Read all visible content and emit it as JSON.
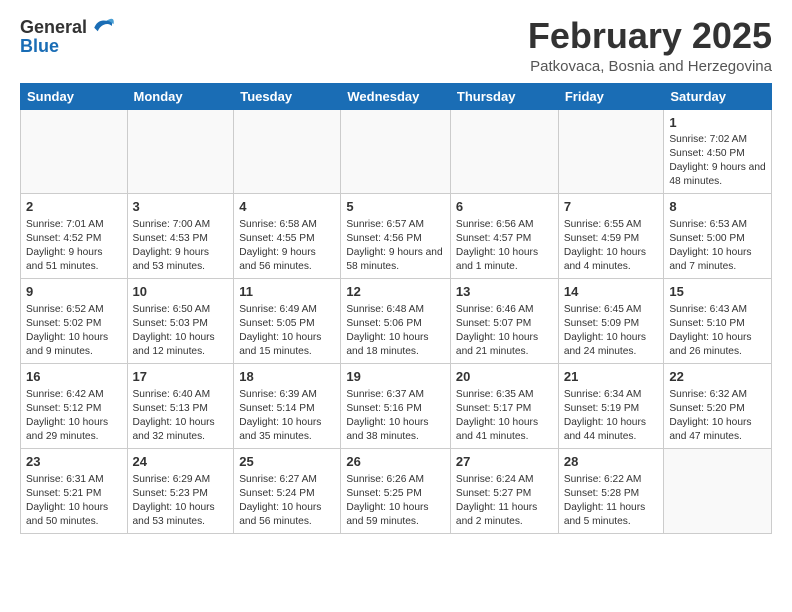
{
  "header": {
    "logo_line1": "General",
    "logo_line2": "Blue",
    "title": "February 2025",
    "subtitle": "Patkovaca, Bosnia and Herzegovina"
  },
  "days_of_week": [
    "Sunday",
    "Monday",
    "Tuesday",
    "Wednesday",
    "Thursday",
    "Friday",
    "Saturday"
  ],
  "weeks": [
    [
      {
        "day": "",
        "info": ""
      },
      {
        "day": "",
        "info": ""
      },
      {
        "day": "",
        "info": ""
      },
      {
        "day": "",
        "info": ""
      },
      {
        "day": "",
        "info": ""
      },
      {
        "day": "",
        "info": ""
      },
      {
        "day": "1",
        "info": "Sunrise: 7:02 AM\nSunset: 4:50 PM\nDaylight: 9 hours and 48 minutes."
      }
    ],
    [
      {
        "day": "2",
        "info": "Sunrise: 7:01 AM\nSunset: 4:52 PM\nDaylight: 9 hours and 51 minutes."
      },
      {
        "day": "3",
        "info": "Sunrise: 7:00 AM\nSunset: 4:53 PM\nDaylight: 9 hours and 53 minutes."
      },
      {
        "day": "4",
        "info": "Sunrise: 6:58 AM\nSunset: 4:55 PM\nDaylight: 9 hours and 56 minutes."
      },
      {
        "day": "5",
        "info": "Sunrise: 6:57 AM\nSunset: 4:56 PM\nDaylight: 9 hours and 58 minutes."
      },
      {
        "day": "6",
        "info": "Sunrise: 6:56 AM\nSunset: 4:57 PM\nDaylight: 10 hours and 1 minute."
      },
      {
        "day": "7",
        "info": "Sunrise: 6:55 AM\nSunset: 4:59 PM\nDaylight: 10 hours and 4 minutes."
      },
      {
        "day": "8",
        "info": "Sunrise: 6:53 AM\nSunset: 5:00 PM\nDaylight: 10 hours and 7 minutes."
      }
    ],
    [
      {
        "day": "9",
        "info": "Sunrise: 6:52 AM\nSunset: 5:02 PM\nDaylight: 10 hours and 9 minutes."
      },
      {
        "day": "10",
        "info": "Sunrise: 6:50 AM\nSunset: 5:03 PM\nDaylight: 10 hours and 12 minutes."
      },
      {
        "day": "11",
        "info": "Sunrise: 6:49 AM\nSunset: 5:05 PM\nDaylight: 10 hours and 15 minutes."
      },
      {
        "day": "12",
        "info": "Sunrise: 6:48 AM\nSunset: 5:06 PM\nDaylight: 10 hours and 18 minutes."
      },
      {
        "day": "13",
        "info": "Sunrise: 6:46 AM\nSunset: 5:07 PM\nDaylight: 10 hours and 21 minutes."
      },
      {
        "day": "14",
        "info": "Sunrise: 6:45 AM\nSunset: 5:09 PM\nDaylight: 10 hours and 24 minutes."
      },
      {
        "day": "15",
        "info": "Sunrise: 6:43 AM\nSunset: 5:10 PM\nDaylight: 10 hours and 26 minutes."
      }
    ],
    [
      {
        "day": "16",
        "info": "Sunrise: 6:42 AM\nSunset: 5:12 PM\nDaylight: 10 hours and 29 minutes."
      },
      {
        "day": "17",
        "info": "Sunrise: 6:40 AM\nSunset: 5:13 PM\nDaylight: 10 hours and 32 minutes."
      },
      {
        "day": "18",
        "info": "Sunrise: 6:39 AM\nSunset: 5:14 PM\nDaylight: 10 hours and 35 minutes."
      },
      {
        "day": "19",
        "info": "Sunrise: 6:37 AM\nSunset: 5:16 PM\nDaylight: 10 hours and 38 minutes."
      },
      {
        "day": "20",
        "info": "Sunrise: 6:35 AM\nSunset: 5:17 PM\nDaylight: 10 hours and 41 minutes."
      },
      {
        "day": "21",
        "info": "Sunrise: 6:34 AM\nSunset: 5:19 PM\nDaylight: 10 hours and 44 minutes."
      },
      {
        "day": "22",
        "info": "Sunrise: 6:32 AM\nSunset: 5:20 PM\nDaylight: 10 hours and 47 minutes."
      }
    ],
    [
      {
        "day": "23",
        "info": "Sunrise: 6:31 AM\nSunset: 5:21 PM\nDaylight: 10 hours and 50 minutes."
      },
      {
        "day": "24",
        "info": "Sunrise: 6:29 AM\nSunset: 5:23 PM\nDaylight: 10 hours and 53 minutes."
      },
      {
        "day": "25",
        "info": "Sunrise: 6:27 AM\nSunset: 5:24 PM\nDaylight: 10 hours and 56 minutes."
      },
      {
        "day": "26",
        "info": "Sunrise: 6:26 AM\nSunset: 5:25 PM\nDaylight: 10 hours and 59 minutes."
      },
      {
        "day": "27",
        "info": "Sunrise: 6:24 AM\nSunset: 5:27 PM\nDaylight: 11 hours and 2 minutes."
      },
      {
        "day": "28",
        "info": "Sunrise: 6:22 AM\nSunset: 5:28 PM\nDaylight: 11 hours and 5 minutes."
      },
      {
        "day": "",
        "info": ""
      }
    ]
  ]
}
